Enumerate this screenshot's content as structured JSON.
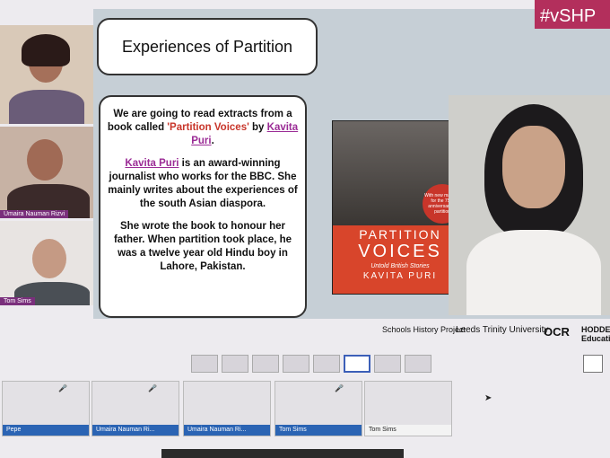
{
  "slide": {
    "title": "Experiences of Partition",
    "hashtag": "#vSHP",
    "para1_pre": "We are going to read extracts from a book called ",
    "para1_book": "'Partition Voices'",
    "para1_by": " by ",
    "para1_author": "Kavita Puri",
    "para1_end": ".",
    "para2_author": "Kavita Puri",
    "para2_rest": " is an award-winning journalist who works for the BBC. She mainly writes about the experiences of the south Asian diaspora.",
    "para3": "She wrote the book to honour her father.  When partition took place, he was a twelve year old Hindu boy in Lahore, Pakistan.",
    "book": {
      "title_top": "PARTITION",
      "title_bottom": "VOICES",
      "subtitle": "Untold British Stories",
      "author": "KAVITA PURI",
      "badge": "With new material for the 75th anniversary of partition"
    },
    "logos": {
      "shp": "Schools History Project",
      "ltu": "Leeds Trinity University",
      "ocr": "OCR",
      "hodder": "HODDER Education"
    }
  },
  "speakers": [
    {
      "name": ""
    },
    {
      "name": "Umaira Nauman Rizvi"
    },
    {
      "name": "Tom Sims"
    }
  ],
  "participants": [
    {
      "name": "Pepe"
    },
    {
      "name": "Umaira Nauman Ri..."
    },
    {
      "name": "Umaira Nauman Ri..."
    },
    {
      "name": "Tom Sims"
    },
    {
      "name": "Tom Sims"
    }
  ],
  "colors": {
    "accent": "#9b2c96",
    "label_bar": "#2b64b4",
    "active_layout": "#3c5fb8"
  }
}
